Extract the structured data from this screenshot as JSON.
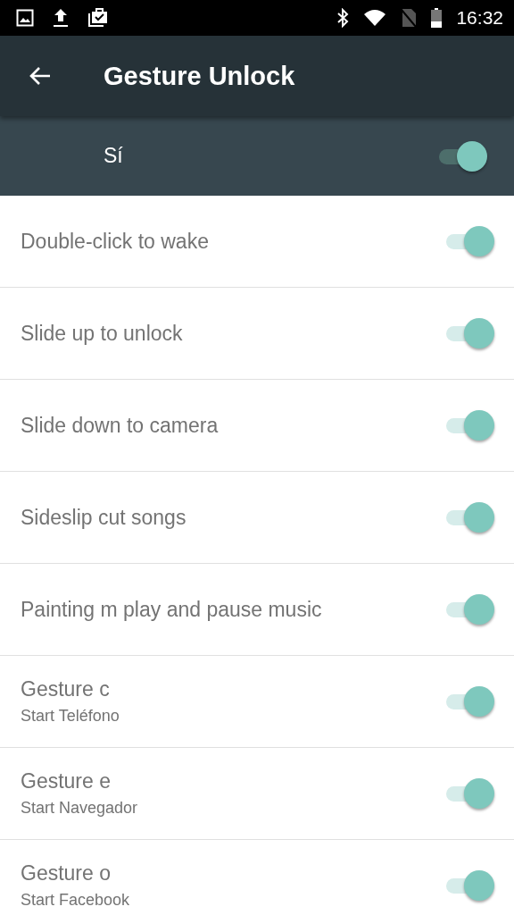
{
  "status_bar": {
    "time": "16:32"
  },
  "app_bar": {
    "title": "Gesture Unlock"
  },
  "master": {
    "label": "Sí",
    "on": true
  },
  "settings": [
    {
      "title": "Double-click to wake",
      "on": true
    },
    {
      "title": "Slide up to unlock",
      "on": true
    },
    {
      "title": "Slide down to camera",
      "on": true
    },
    {
      "title": "Sideslip cut songs",
      "on": true
    },
    {
      "title": "Painting m play and pause music",
      "on": true
    },
    {
      "title": "Gesture c",
      "subtitle": "Start Teléfono",
      "on": true
    },
    {
      "title": "Gesture e",
      "subtitle": "Start Navegador",
      "on": true
    },
    {
      "title": "Gesture o",
      "subtitle": "Start Facebook",
      "on": true
    }
  ]
}
